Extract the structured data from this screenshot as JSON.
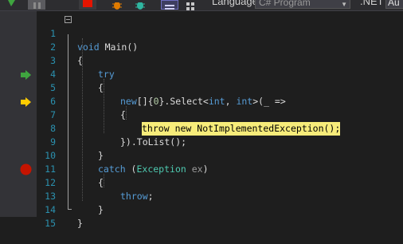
{
  "toolbar": {
    "language_label": "Language",
    "language_value": "C# Program",
    "framework_label": ".NET",
    "framework_value": "Au"
  },
  "editor": {
    "lines": [
      {
        "n": "1"
      },
      {
        "n": "2"
      },
      {
        "n": "3"
      },
      {
        "n": "4"
      },
      {
        "n": "5"
      },
      {
        "n": "6"
      },
      {
        "n": "7"
      },
      {
        "n": "8"
      },
      {
        "n": "9"
      },
      {
        "n": "10"
      },
      {
        "n": "11"
      },
      {
        "n": "12"
      },
      {
        "n": "13"
      },
      {
        "n": "14"
      },
      {
        "n": "15"
      }
    ],
    "tokens": {
      "l1_void": "void",
      "l1_main": " Main()",
      "l2": "{",
      "l3_try": "try",
      "l4": "{",
      "l5_new": "new",
      "l5_a": "[]{",
      "l5_zero": "0",
      "l5_b": "}.Select<",
      "l5_int1": "int",
      "l5_c": ", ",
      "l5_int2": "int",
      "l5_d": ">(_ =>",
      "l6": "{",
      "l7_throw": "throw",
      "l7_sp": " ",
      "l7_new": "new",
      "l7_rest": " NotImplementedException();",
      "l8": "}).ToList();",
      "l9": "}",
      "l10_catch": "catch",
      "l10_a": " (",
      "l10_type": "Exception",
      "l10_sp": " ",
      "l10_ex": "ex",
      "l10_b": ")",
      "l11": "{",
      "l12_throw": "throw",
      "l12_semi": ";",
      "l13": "}",
      "l14": "}"
    }
  },
  "colors": {
    "keyword": "#569cd6",
    "type": "#4ec9b0",
    "number": "#b5cea8",
    "line_number": "#2b91af",
    "highlight": "#f7ec7a",
    "breakpoint": "#e51400",
    "current_arrow": "#ffcc00",
    "call_stack_arrow": "#3fa53f"
  },
  "markers": {
    "call_stack": "green-arrow-icon",
    "current_statement": "yellow-arrow-icon",
    "breakpoint": "breakpoint-icon"
  }
}
